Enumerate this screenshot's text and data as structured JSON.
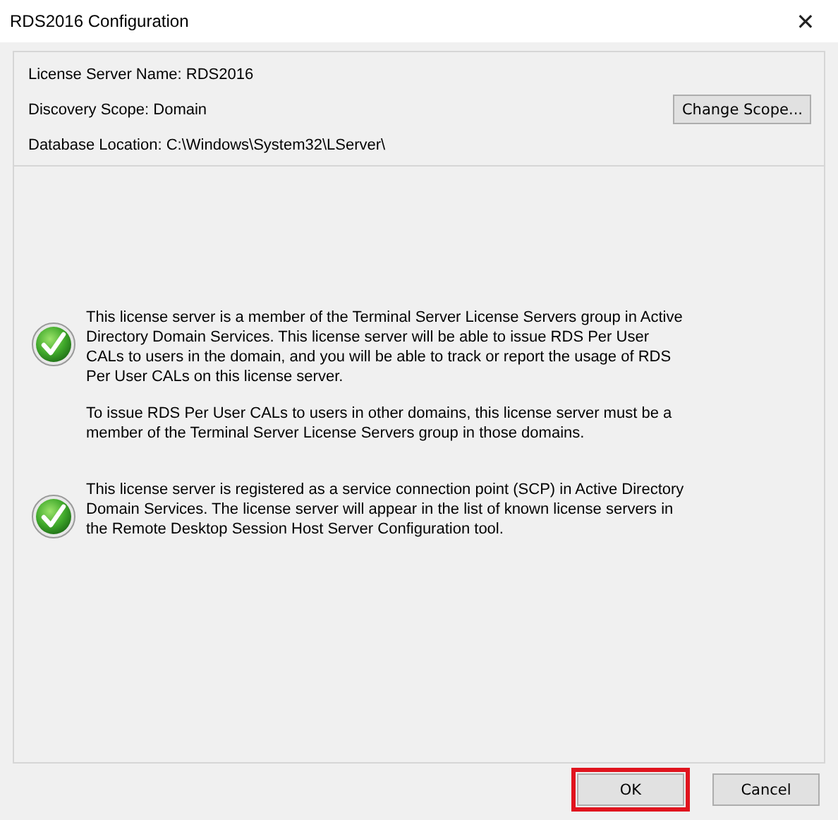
{
  "window": {
    "title": "RDS2016 Configuration",
    "close": "✕"
  },
  "info": [
    {
      "text": "License Server Name: RDS2016"
    },
    {
      "text": "Discovery Scope: Domain",
      "button": "Change Scope..."
    },
    {
      "text": "Database Location: C:\\Windows\\System32\\LServer\\"
    }
  ],
  "messages": [
    {
      "kind": "success",
      "paragraphs": [
        "This license server is a member of the Terminal Server License Servers group in Active Directory Domain Services. This license server will be able to issue RDS Per User CALs to users in the domain, and you will be able to track or report the usage of RDS Per User CALs on this license server.",
        "To issue RDS Per User CALs to users in other domains, this license server must be a member of the Terminal Server License Servers group in those domains."
      ]
    },
    {
      "kind": "success",
      "paragraphs": [
        "This license server is registered as a service connection point (SCP) in Active Directory Domain Services. The license server will appear in the list of known license servers in the Remote Desktop Session Host Server Configuration tool."
      ]
    }
  ],
  "buttons": [
    {
      "label": "OK",
      "highlighted": true
    },
    {
      "label": "Cancel",
      "highlighted": false
    }
  ]
}
